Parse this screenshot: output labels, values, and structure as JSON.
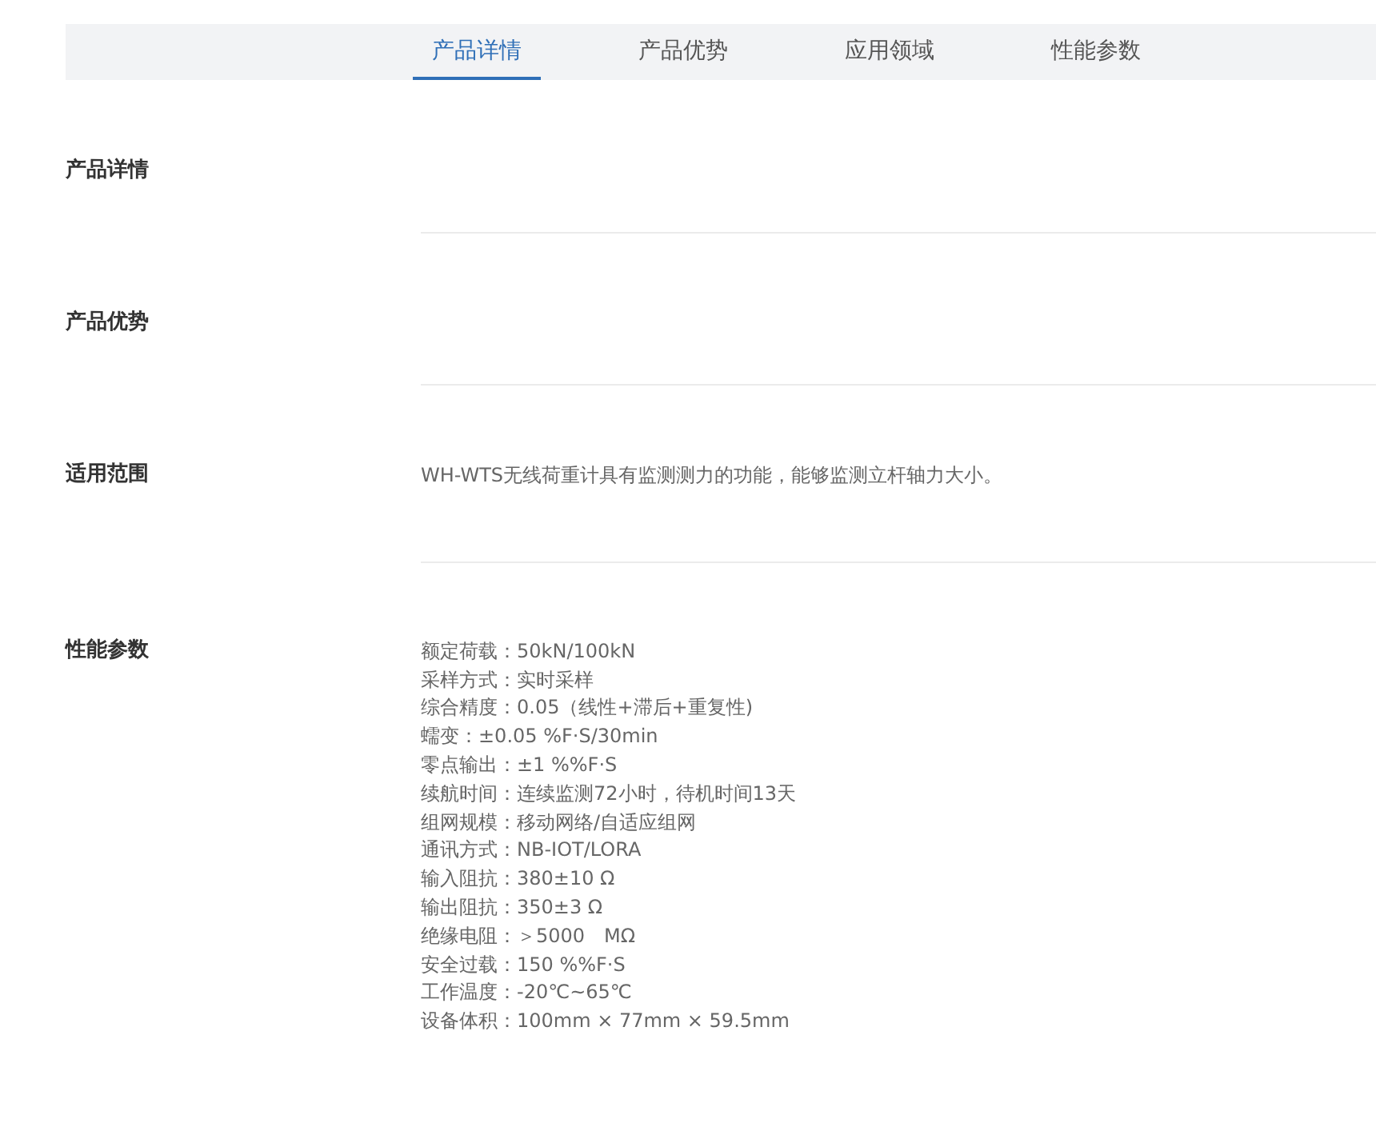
{
  "tabs": [
    {
      "label": "产品详情",
      "selected": true
    },
    {
      "label": "产品优势",
      "selected": false
    },
    {
      "label": "应用领域",
      "selected": false
    },
    {
      "label": "性能参数",
      "selected": false
    }
  ],
  "sections": [
    {
      "heading": "产品详情"
    },
    {
      "heading": "产品优势"
    },
    {
      "heading": "适用范围",
      "lines": [
        "WH-WTS无线荷重计具有监测测力的功能，能够监测立杆轴力大小。"
      ]
    },
    {
      "heading": "性能参数",
      "lines": [
        "额定荷载：50kN/100kN",
        "采样方式：实时采样",
        "综合精度：0.05（线性+滞后+重复性)",
        "蠕变：±0.05 %F·S/30min",
        "零点输出：±1 %%F·S",
        "续航时间：连续监测72小时，待机时间13天",
        "组网规模：移动网络/自适应组网",
        "通讯方式：NB-IOT/LORA",
        "输入阻抗：380±10 Ω",
        "输出阻抗：350±3 Ω",
        "绝缘电阻：＞5000　MΩ",
        "安全过载：150 %%F·S",
        "工作温度：-20℃~65℃",
        "设备体积：100mm × 77mm × 59.5mm"
      ]
    }
  ]
}
